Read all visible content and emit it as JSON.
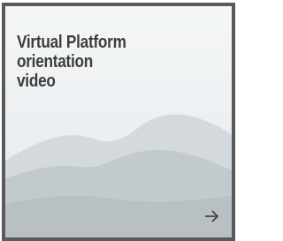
{
  "card": {
    "title_lines": [
      "Virtual Platform",
      "orientation",
      "video"
    ],
    "arrow_icon": "arrow-right-icon",
    "border_color": "#5a5a5a",
    "title_color": "#3d3d3d"
  }
}
